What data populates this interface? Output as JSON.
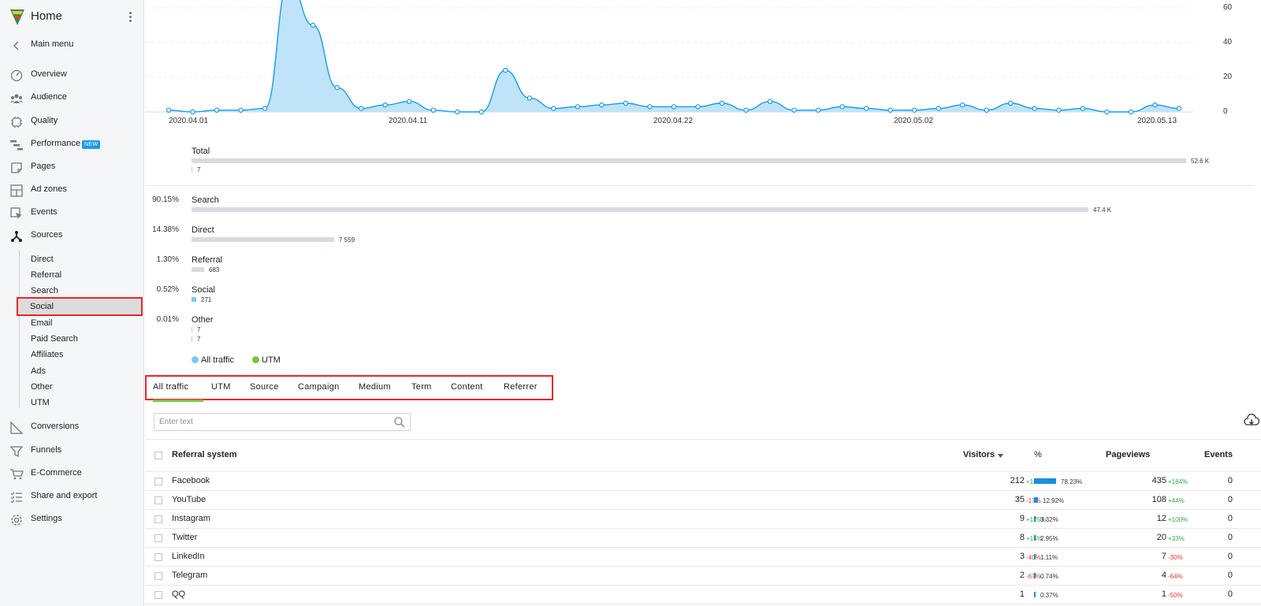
{
  "sidebar": {
    "title": "Home",
    "main_menu": "Main menu",
    "items": {
      "overview": "Overview",
      "audience": "Audience",
      "quality": "Quality",
      "performance": "Performance",
      "performance_badge": "NEW",
      "pages": "Pages",
      "ad_zones": "Ad zones",
      "events": "Events",
      "sources": "Sources",
      "conversions": "Conversions",
      "funnels": "Funnels",
      "ecommerce": "E-Commerce",
      "share_export": "Share and export",
      "settings": "Settings"
    },
    "sources_sub": [
      "Direct",
      "Referral",
      "Search",
      "Social",
      "Email",
      "Paid Search",
      "Affiliates",
      "Ads",
      "Other",
      "UTM"
    ],
    "active_sub": "Social"
  },
  "chart_data": {
    "type": "area",
    "x_tick_labels": [
      "2020.04.01",
      "2020.04.11",
      "2020.04.22",
      "2020.05.02",
      "2020.05.13"
    ],
    "y_tick_labels": [
      "0",
      "20",
      "40",
      "60"
    ],
    "ylim": [
      0,
      60
    ],
    "series": [
      {
        "values": [
          1,
          0,
          1,
          1,
          2,
          75,
          50,
          14,
          2,
          4,
          6,
          1,
          0,
          0,
          24,
          8,
          2,
          3,
          4,
          5,
          3,
          3,
          3,
          5,
          1,
          6,
          1,
          1,
          3,
          2,
          1,
          1,
          2,
          4,
          1,
          5,
          2,
          1,
          2,
          0,
          0,
          4,
          2
        ]
      }
    ],
    "color": "#1a9be6",
    "fill": "#bfe3f8"
  },
  "summary": {
    "total_label": "Total",
    "total_value": "52.6 K",
    "total_sub": "7",
    "rows": [
      {
        "pct": "90.15%",
        "name": "Search",
        "value": "47.4 K",
        "fraction": 0.9015
      },
      {
        "pct": "14.38%",
        "name": "Direct",
        "value": "7 559",
        "fraction": 0.1438
      },
      {
        "pct": "1.30%",
        "name": "Referral",
        "value": "683",
        "fraction": 0.013
      },
      {
        "pct": "0.52%",
        "name": "Social",
        "value": "271",
        "fraction": 0.0052
      },
      {
        "pct": "0.01%",
        "name": "Other",
        "value": "7",
        "value2": "7",
        "fraction": 0.0001
      }
    ],
    "legend": [
      {
        "label": "All traffic",
        "color": "#7ec8f2"
      },
      {
        "label": "UTM",
        "color": "#7dc142"
      }
    ]
  },
  "tabs": [
    "All traffic",
    "UTM",
    "Source",
    "Campaign",
    "Medium",
    "Term",
    "Content",
    "Referrer"
  ],
  "active_tab": "All traffic",
  "search": {
    "placeholder": "Enter text"
  },
  "table": {
    "headers": {
      "name": "Referral system",
      "visitors": "Visitors",
      "pct": "%",
      "pageviews": "Pageviews",
      "events": "Events"
    },
    "rows": [
      {
        "name": "Facebook",
        "visitors": "212",
        "v_delta": "+108%",
        "v_up": true,
        "pct": "78.23%",
        "frac": 0.7823,
        "pageviews": "435",
        "p_delta": "+184%",
        "p_up": true,
        "events": "0"
      },
      {
        "name": "YouTube",
        "visitors": "35",
        "v_delta": "-17%",
        "v_up": false,
        "pct": "12.92%",
        "frac": 0.1292,
        "pageviews": "108",
        "p_delta": "+44%",
        "p_up": true,
        "events": "0"
      },
      {
        "name": "Instagram",
        "visitors": "9",
        "v_delta": "+125%",
        "v_up": true,
        "pct": "3.32%",
        "frac": 0.0332,
        "pageviews": "12",
        "p_delta": "+100%",
        "p_up": true,
        "events": "0"
      },
      {
        "name": "Twitter",
        "visitors": "8",
        "v_delta": "+14%",
        "v_up": true,
        "pct": "2.95%",
        "frac": 0.0295,
        "pageviews": "20",
        "p_delta": "+33%",
        "p_up": true,
        "events": "0"
      },
      {
        "name": "LinkedIn",
        "visitors": "3",
        "v_delta": "-40%",
        "v_up": false,
        "pct": "1.11%",
        "frac": 0.0111,
        "pageviews": "7",
        "p_delta": "-30%",
        "p_up": false,
        "events": "0"
      },
      {
        "name": "Telegram",
        "visitors": "2",
        "v_delta": "-67%",
        "v_up": false,
        "pct": "0.74%",
        "frac": 0.0074,
        "pageviews": "4",
        "p_delta": "-64%",
        "p_up": false,
        "events": "0"
      },
      {
        "name": "QQ",
        "visitors": "1",
        "v_delta": "",
        "v_up": true,
        "pct": "0.37%",
        "frac": 0.0037,
        "pageviews": "1",
        "p_delta": "-50%",
        "p_up": false,
        "events": "0"
      }
    ]
  }
}
